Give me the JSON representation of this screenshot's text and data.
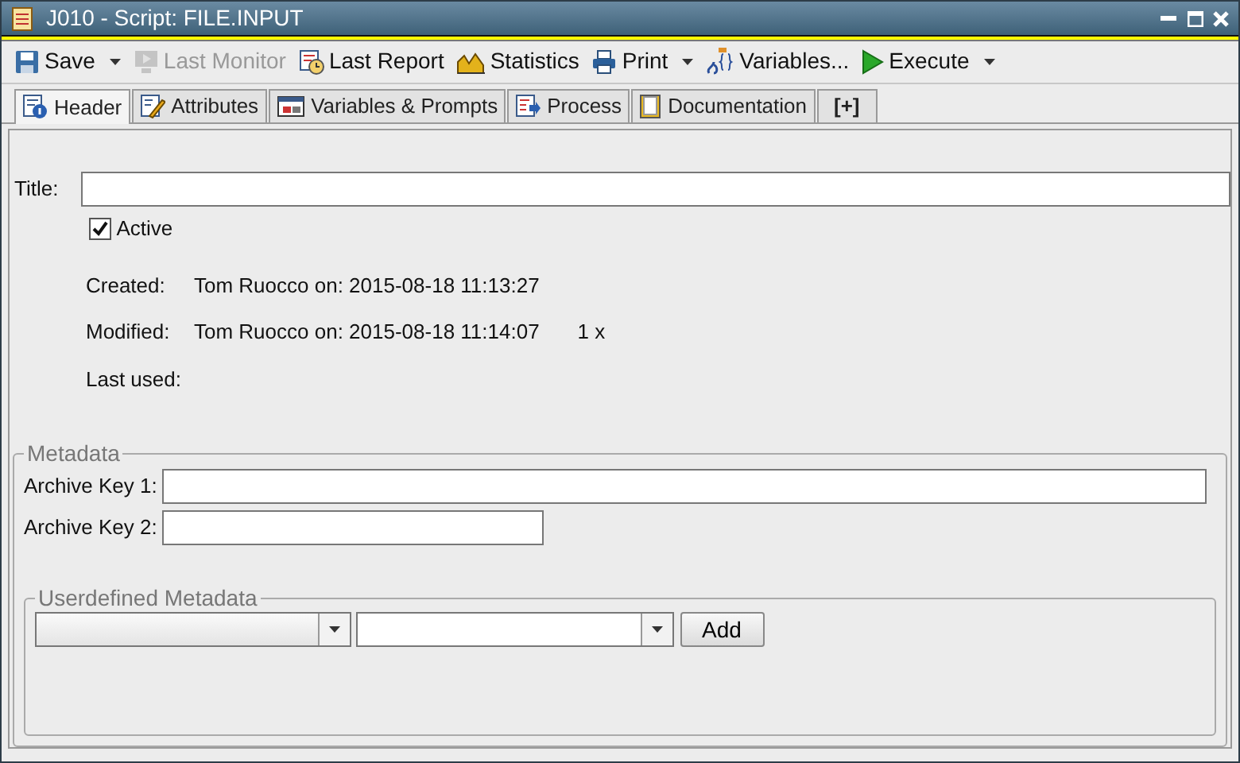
{
  "window": {
    "title": "J010 - Script: FILE.INPUT"
  },
  "toolbar": [
    {
      "kind": "save",
      "label": "Save",
      "disabled": false,
      "dropdown": true
    },
    {
      "kind": "monitor",
      "label": "Last Monitor",
      "disabled": true,
      "dropdown": false
    },
    {
      "kind": "report",
      "label": "Last Report",
      "disabled": false,
      "dropdown": false
    },
    {
      "kind": "statistics",
      "label": "Statistics",
      "disabled": false,
      "dropdown": false
    },
    {
      "kind": "print",
      "label": "Print",
      "disabled": false,
      "dropdown": true
    },
    {
      "kind": "variables",
      "label": "Variables...",
      "disabled": false,
      "dropdown": false
    },
    {
      "kind": "execute",
      "label": "Execute",
      "disabled": false,
      "dropdown": true
    }
  ],
  "tabs": [
    {
      "kind": "header",
      "label": "Header",
      "selected": true
    },
    {
      "kind": "attributes",
      "label": "Attributes",
      "selected": false
    },
    {
      "kind": "variables",
      "label": "Variables & Prompts",
      "selected": false
    },
    {
      "kind": "process",
      "label": "Process",
      "selected": false
    },
    {
      "kind": "documentation",
      "label": "Documentation",
      "selected": false
    },
    {
      "kind": "add",
      "label": "[+]",
      "selected": false
    }
  ],
  "header": {
    "title_label": "Title:",
    "active": {
      "label": "Active",
      "checked": true
    },
    "info": [
      {
        "label": "Created:",
        "value": "Tom Ruocco on: 2015-08-18 11:13:27"
      },
      {
        "label": "Modified:",
        "value": "Tom Ruocco on: 2015-08-18 11:14:07",
        "count": "1 x"
      },
      {
        "label": "Last used:"
      }
    ]
  },
  "metadata": {
    "legend": "Metadata",
    "archive_keys": [
      {
        "label": "Archive Key 1:"
      },
      {
        "label": "Archive Key 2:"
      }
    ],
    "userdefined": {
      "legend": "Userdefined Metadata",
      "button": "Add"
    }
  }
}
